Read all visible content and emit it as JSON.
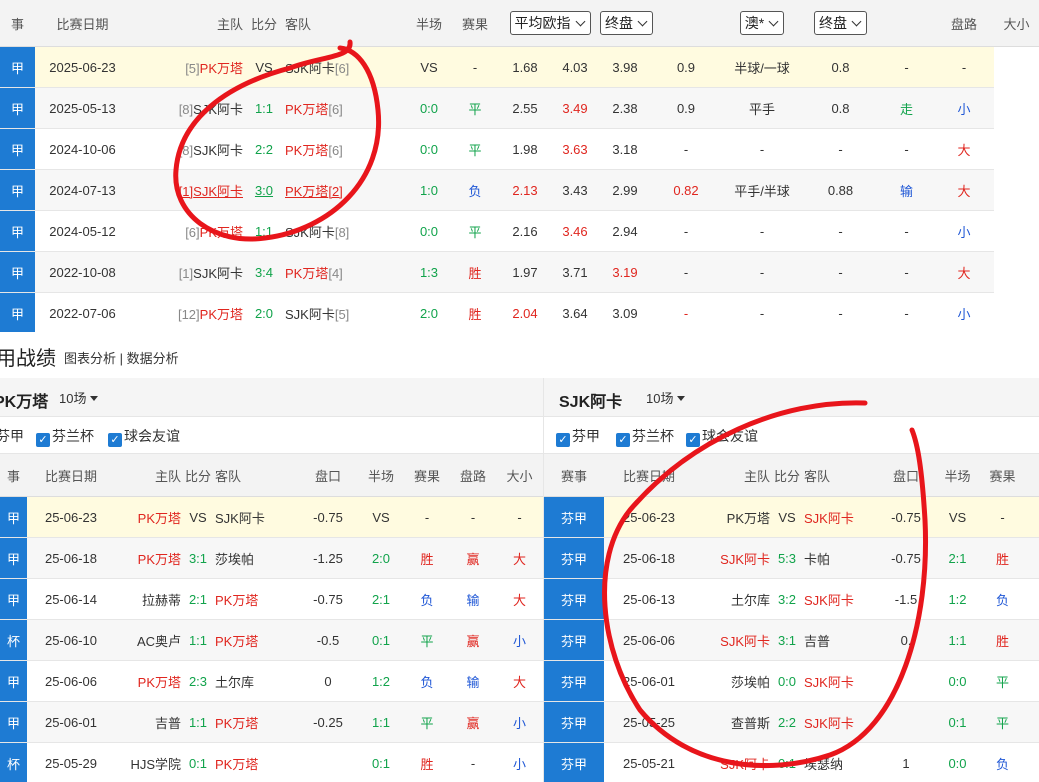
{
  "h2h": {
    "headers": {
      "league": "事",
      "date": "比赛日期",
      "home": "主队",
      "score": "比分",
      "away": "客队",
      "half": "半场",
      "result": "赛果",
      "avg_odds": "平均欧指",
      "final1": "终盘",
      "bookmaker": "澳*",
      "final2": "终盘",
      "handicap_trend": "盘路",
      "ou": "大小"
    },
    "rows": [
      {
        "league": "甲",
        "date": "2025-06-23",
        "home_rank": "[5]",
        "home": "PK万塔",
        "score": "VS",
        "away": "SJK阿卡",
        "away_rank": "[6]",
        "half": "VS",
        "result": "-",
        "o1": "1.68",
        "o2": "4.03",
        "o3": "3.98",
        "a1": "0.9",
        "line": "半球/一球",
        "a2": "0.8",
        "trend": "-",
        "ou": "-"
      },
      {
        "league": "甲",
        "date": "2025-05-13",
        "home_rank": "[8]",
        "home": "SJK阿卡",
        "score": "1:1",
        "away": "PK万塔",
        "away_rank": "[6]",
        "half": "0:0",
        "result": "平",
        "o1": "2.55",
        "o2": "3.49",
        "o3": "2.38",
        "a1": "0.9",
        "line": "平手",
        "a2": "0.8",
        "trend": "走",
        "ou": "小"
      },
      {
        "league": "甲",
        "date": "2024-10-06",
        "home_rank": "[8]",
        "home": "SJK阿卡",
        "score": "2:2",
        "away": "PK万塔",
        "away_rank": "[6]",
        "half": "0:0",
        "result": "平",
        "o1": "1.98",
        "o2": "3.63",
        "o3": "3.18",
        "a1": "-",
        "line": "-",
        "a2": "-",
        "trend": "-",
        "ou": "大"
      },
      {
        "league": "甲",
        "date": "2024-07-13",
        "home_rank": "[1]",
        "home": "SJK阿卡",
        "score": "3:0",
        "away": "PK万塔",
        "away_rank": "[2]",
        "half": "1:0",
        "result": "负",
        "o1": "2.13",
        "o2": "3.43",
        "o3": "2.99",
        "a1": "0.82",
        "line": "平手/半球",
        "a2": "0.88",
        "trend": "输",
        "ou": "大"
      },
      {
        "league": "甲",
        "date": "2024-05-12",
        "home_rank": "[6]",
        "home": "PK万塔",
        "score": "1:1",
        "away": "SJK阿卡",
        "away_rank": "[8]",
        "half": "0:0",
        "result": "平",
        "o1": "2.16",
        "o2": "3.46",
        "o3": "2.94",
        "a1": "-",
        "line": "-",
        "a2": "-",
        "trend": "-",
        "ou": "小"
      },
      {
        "league": "甲",
        "date": "2022-10-08",
        "home_rank": "[1]",
        "home": "SJK阿卡",
        "score": "3:4",
        "away": "PK万塔",
        "away_rank": "[4]",
        "half": "1:3",
        "result": "胜",
        "o1": "1.97",
        "o2": "3.71",
        "o3": "3.19",
        "a1": "-",
        "line": "-",
        "a2": "-",
        "trend": "-",
        "ou": "大"
      },
      {
        "league": "甲",
        "date": "2022-07-06",
        "home_rank": "[12]",
        "home": "PK万塔",
        "score": "2:0",
        "away": "SJK阿卡",
        "away_rank": "[5]",
        "half": "2:0",
        "result": "胜",
        "o1": "2.04",
        "o2": "3.64",
        "o3": "3.09",
        "a1": "-",
        "line": "-",
        "a2": "-",
        "trend": "-",
        "ou": "小"
      }
    ]
  },
  "section": {
    "title": "用战绩",
    "link1": "图表分析",
    "sep": "|",
    "link2": "数据分析"
  },
  "left": {
    "team": "PK万塔",
    "count": "10场",
    "filters": [
      "芬甲",
      "芬兰杯",
      "球会友谊"
    ],
    "headers": {
      "league": "事",
      "date": "比赛日期",
      "home": "主队",
      "score": "比分",
      "away": "客队",
      "hcp": "盘口",
      "half": "半场",
      "result": "赛果",
      "trend": "盘路",
      "ou": "大小"
    },
    "rows": [
      {
        "league": "甲",
        "date": "25-06-23",
        "home": "PK万塔",
        "score": "VS",
        "away": "SJK阿卡",
        "hcp": "-0.75",
        "half": "VS",
        "result": "-",
        "trend": "-",
        "ou": "-"
      },
      {
        "league": "甲",
        "date": "25-06-18",
        "home": "PK万塔",
        "score": "3:1",
        "away": "莎埃帕",
        "hcp": "-1.25",
        "half": "2:0",
        "result": "胜",
        "trend": "赢",
        "ou": "大"
      },
      {
        "league": "甲",
        "date": "25-06-14",
        "home": "拉赫蒂",
        "score": "2:1",
        "away": "PK万塔",
        "hcp": "-0.75",
        "half": "2:1",
        "result": "负",
        "trend": "输",
        "ou": "大"
      },
      {
        "league": "杯",
        "date": "25-06-10",
        "home": "AC奥卢",
        "score": "1:1",
        "away": "PK万塔",
        "hcp": "-0.5",
        "half": "0:1",
        "result": "平",
        "trend": "赢",
        "ou": "小"
      },
      {
        "league": "甲",
        "date": "25-06-06",
        "home": "PK万塔",
        "score": "2:3",
        "away": "土尔库",
        "hcp": "0",
        "half": "1:2",
        "result": "负",
        "trend": "输",
        "ou": "大"
      },
      {
        "league": "甲",
        "date": "25-06-01",
        "home": "吉普",
        "score": "1:1",
        "away": "PK万塔",
        "hcp": "-0.25",
        "half": "1:1",
        "result": "平",
        "trend": "赢",
        "ou": "小"
      },
      {
        "league": "杯",
        "date": "25-05-29",
        "home": "HJS学院",
        "score": "0:1",
        "away": "PK万塔",
        "hcp": "",
        "half": "0:1",
        "result": "胜",
        "trend": "-",
        "ou": "小"
      }
    ]
  },
  "right": {
    "team": "SJK阿卡",
    "count": "10场",
    "filters": [
      "芬甲",
      "芬兰杯",
      "球会友谊"
    ],
    "headers": {
      "league": "赛事",
      "date": "比赛日期",
      "home": "主队",
      "score": "比分",
      "away": "客队",
      "hcp": "盘口",
      "half": "半场",
      "result": "赛果"
    },
    "rows": [
      {
        "league": "芬甲",
        "date": "25-06-23",
        "home": "PK万塔",
        "score": "VS",
        "away": "SJK阿卡",
        "hcp": "-0.75",
        "half": "VS",
        "result": "-"
      },
      {
        "league": "芬甲",
        "date": "25-06-18",
        "home": "SJK阿卡",
        "score": "5:3",
        "away": "卡帕",
        "hcp": "-0.75",
        "half": "2:1",
        "result": "胜"
      },
      {
        "league": "芬甲",
        "date": "25-06-13",
        "home": "土尔库",
        "score": "3:2",
        "away": "SJK阿卡",
        "hcp": "-1.5",
        "half": "1:2",
        "result": "负"
      },
      {
        "league": "芬甲",
        "date": "25-06-06",
        "home": "SJK阿卡",
        "score": "3:1",
        "away": "吉普",
        "hcp": "0.",
        "half": "1:1",
        "result": "胜"
      },
      {
        "league": "芬甲",
        "date": "25-06-01",
        "home": "莎埃帕",
        "score": "0:0",
        "away": "SJK阿卡",
        "hcp": "",
        "half": "0:0",
        "result": "平"
      },
      {
        "league": "芬甲",
        "date": "25-05-25",
        "home": "查普斯",
        "score": "2:2",
        "away": "SJK阿卡",
        "hcp": "",
        "half": "0:1",
        "result": "平"
      },
      {
        "league": "芬甲",
        "date": "25-05-21",
        "home": "SJK阿卡",
        "score": "0:1",
        "away": "埃瑟纳",
        "hcp": "1",
        "half": "0:0",
        "result": "负"
      }
    ]
  },
  "colors": {
    "accent": "#1e7bd3",
    "red": "#e0261f",
    "green": "#11a34b",
    "blue": "#1f57d6",
    "annotation": "#e8151b"
  }
}
